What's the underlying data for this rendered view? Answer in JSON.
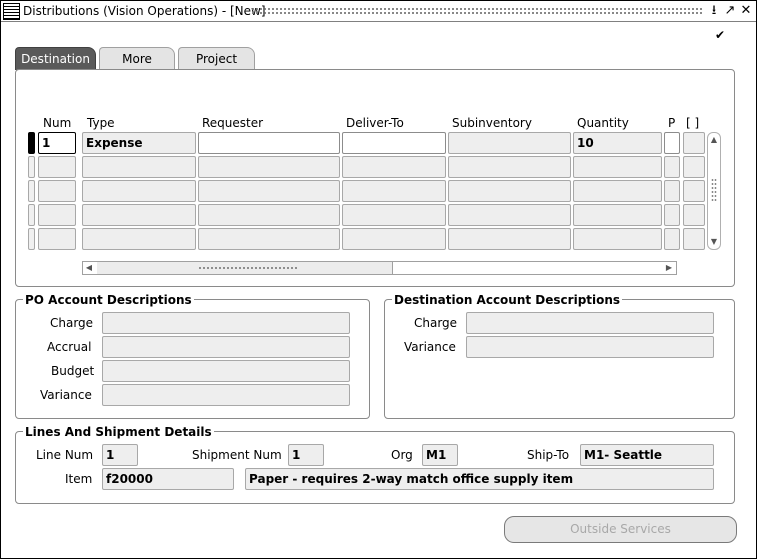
{
  "window": {
    "title": "Distributions (Vision Operations) - [New]",
    "minimize": "⭳",
    "restore": "↗",
    "close": "✕",
    "check": "✔"
  },
  "tabs": [
    "Destination",
    "More",
    "Project"
  ],
  "active_tab": "Destination",
  "grid": {
    "columns": {
      "num": "Num",
      "type": "Type",
      "requester": "Requester",
      "deliver_to": "Deliver-To",
      "subinventory": "Subinventory",
      "quantity": "Quantity",
      "p": "P",
      "bracket": "[ ]"
    },
    "row1": {
      "num": "1",
      "type": "Expense",
      "requester": "",
      "deliver_to": "",
      "subinventory": "",
      "quantity": "10"
    }
  },
  "po_account": {
    "title": "PO Account Descriptions",
    "charge_label": "Charge",
    "accrual_label": "Accrual",
    "budget_label": "Budget",
    "variance_label": "Variance"
  },
  "dest_account": {
    "title": "Destination Account Descriptions",
    "charge_label": "Charge",
    "variance_label": "Variance"
  },
  "details": {
    "title": "Lines And Shipment Details",
    "line_num_label": "Line Num",
    "line_num": "1",
    "shipment_num_label": "Shipment Num",
    "shipment_num": "1",
    "org_label": "Org",
    "org": "M1",
    "ship_to_label": "Ship-To",
    "ship_to": "M1- Seattle",
    "item_label": "Item",
    "item": "f20000",
    "item_description": "Paper - requires 2-way match office supply item"
  },
  "buttons": {
    "outside_services": "Outside Services"
  }
}
